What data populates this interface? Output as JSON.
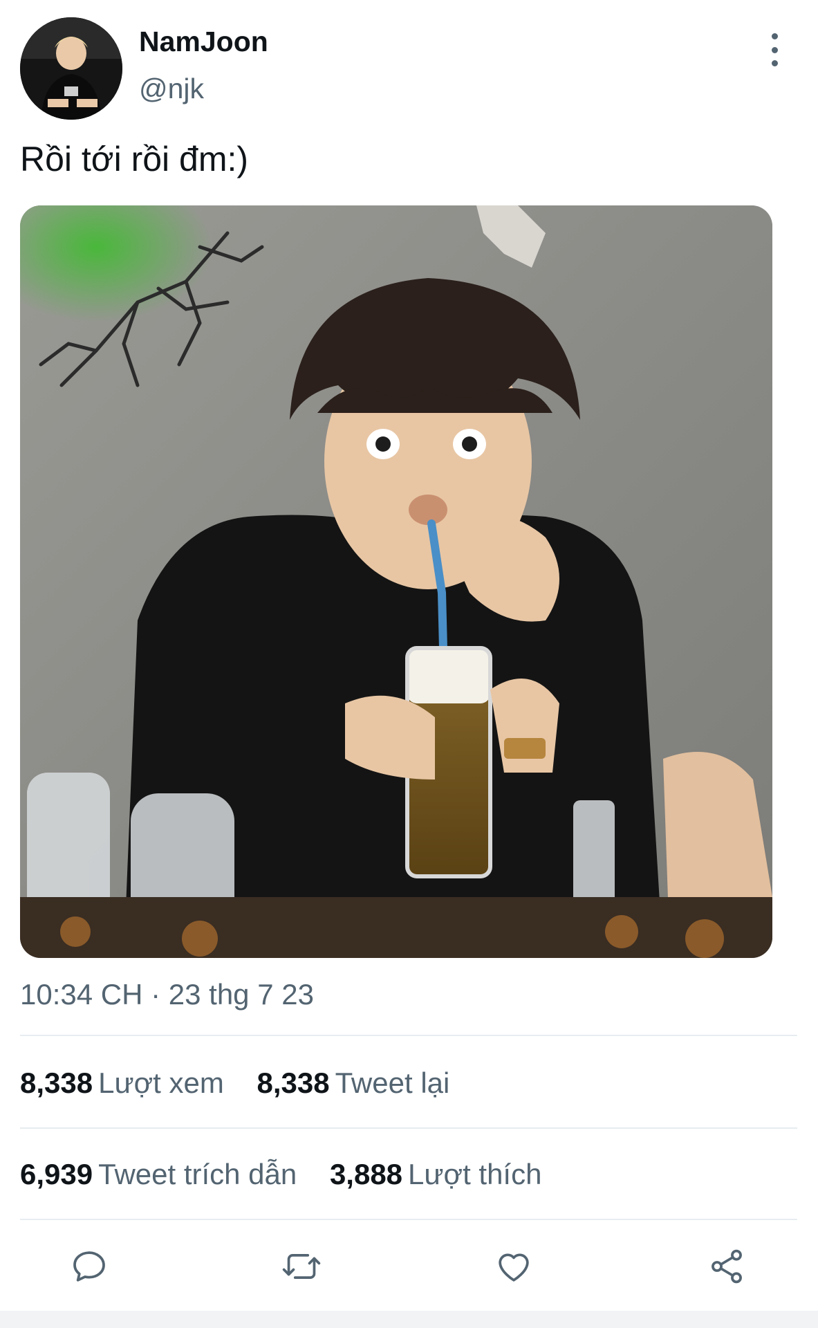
{
  "author": {
    "display_name": "NamJoon",
    "handle": "@njk"
  },
  "tweet": {
    "text": "Rồi tới rồi đm:)",
    "timestamp": "10:34 CH · 23 thg 7 23"
  },
  "stats": {
    "views": {
      "count": "8,338",
      "label": "Lượt xem"
    },
    "retweets": {
      "count": "8,338",
      "label": "Tweet lại"
    },
    "quotes": {
      "count": "6,939",
      "label": "Tweet trích dẫn"
    },
    "likes": {
      "count": "3,888",
      "label": "Lượt thích"
    }
  },
  "actions": {
    "reply_icon": "reply-icon",
    "retweet_icon": "retweet-icon",
    "like_icon": "heart-icon",
    "share_icon": "share-icon"
  },
  "colors": {
    "text_primary": "#0f1419",
    "text_secondary": "#536471",
    "divider": "#e6ecf0"
  }
}
